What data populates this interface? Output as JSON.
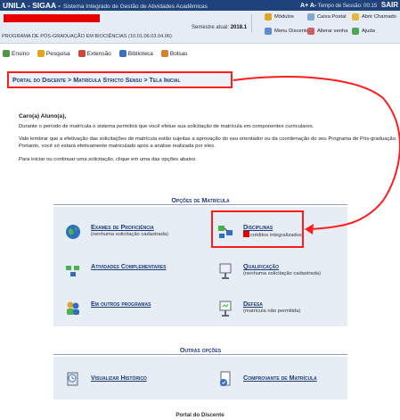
{
  "topbar": {
    "brand": "UNILA - SIGAA -",
    "subtitle": "Sistema Integrado de Gestão de Atividades Acadêmicas",
    "font_controls": "A+ A-",
    "session_label": "Tempo de Sessão: 00:15",
    "sigaa_tag": "SAIR"
  },
  "info": {
    "program": "PROGRAMA DE PÓS-GRADUAÇÃO EM BIOCIÊNCIAS (10.01.06.03.04.06)",
    "semester_label": "Semestre atual:",
    "semester_value": "2018.1",
    "quick_links": [
      {
        "label": "Módulos",
        "icon": "modules-icon",
        "color": "#e0a51f"
      },
      {
        "label": "Caixa Postal",
        "icon": "mailbox-icon",
        "color": "#7fa6d6"
      },
      {
        "label": "Abrir Chamado",
        "icon": "ticket-icon",
        "color": "#e5b73b"
      },
      {
        "label": "Menu Discente",
        "icon": "student-menu-icon",
        "color": "#5c8bd1"
      },
      {
        "label": "Alterar senha",
        "icon": "password-icon",
        "color": "#d35d5d"
      },
      {
        "label": "Ajuda",
        "icon": "help-icon",
        "color": "#4fa84f"
      }
    ]
  },
  "nav": [
    {
      "label": "Ensino",
      "icon": "teaching-icon",
      "color": "#4a9a3f"
    },
    {
      "label": "Pesquisa",
      "icon": "research-icon",
      "color": "#e4a51c"
    },
    {
      "label": "Extensão",
      "icon": "extension-icon",
      "color": "#d0453e"
    },
    {
      "label": "Biblioteca",
      "icon": "library-icon",
      "color": "#3f6fb8"
    },
    {
      "label": "Bolsas",
      "icon": "scholarship-icon",
      "color": "#d9822b"
    }
  ],
  "breadcrumb": "Portal do Discente > Matrícula Stricto Sensu > Tela Inicial",
  "text": {
    "greeting": "Caro(a) Aluno(a),",
    "p1": "Durante o período de matrícula o sistema permitirá que você efetue sua solicitação de matrícula em componentes curriculares.",
    "p2a": "Vale lembrar que a efetivação das solicitações de matrícula estão sujeitas a aprovação do seu orientador ou da coordenação do seu Programa de Pós-graduação.",
    "p2b": "Portanto, você só estará efetivamente matriculado após a análise realizada por eles.",
    "p3": "Para iniciar ou continuar uma solicitação, clique em uma das opções abaixo."
  },
  "matricula": {
    "title": "Opções de Matrícula",
    "options": [
      {
        "title": "Exames de Proficiência",
        "desc": "(nenhuma solicitação cadastrada)",
        "icon": "globe-icon"
      },
      {
        "title": "Disciplinas",
        "desc": "créditos integralizados",
        "icon": "disciplines-icon"
      },
      {
        "title": "Atividades Complementares",
        "desc": "",
        "icon": "activities-icon"
      },
      {
        "title": "Qualificação",
        "desc": "(nenhuma solicitação cadastrada)",
        "icon": "qualification-icon"
      },
      {
        "title": "Em outros programas",
        "desc": "",
        "icon": "users-icon"
      },
      {
        "title": "Defesa",
        "desc": "(matrícula não permitida)",
        "icon": "defense-icon"
      }
    ]
  },
  "outras": {
    "title": "Outras opções",
    "options": [
      {
        "title": "Visualizar Histórico",
        "icon": "history-icon"
      },
      {
        "title": "Comprovante de Matrícula",
        "icon": "receipt-icon"
      }
    ]
  },
  "footer": "Portal do Discente"
}
